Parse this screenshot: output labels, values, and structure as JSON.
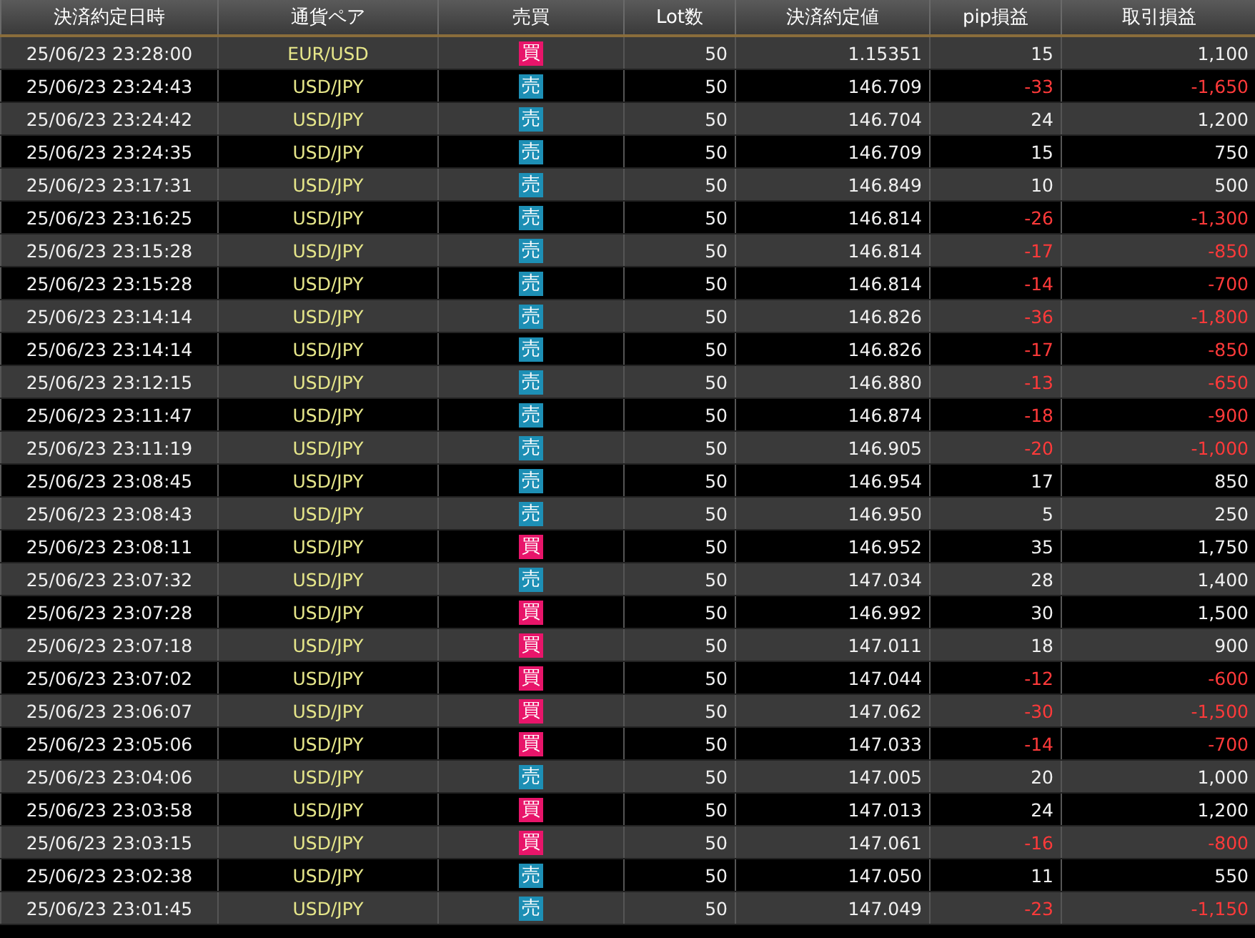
{
  "table": {
    "columns": [
      "決済約定日時",
      "通貨ペア",
      "売買",
      "Lot数",
      "決済約定値",
      "pip損益",
      "取引損益"
    ],
    "rows": [
      {
        "time": "25/06/23 23:28:00",
        "pair": "EUR/USD",
        "side": {
          "label": "買",
          "kind": "buy"
        },
        "lots": "50",
        "price": "1.15351",
        "pips": "15",
        "profit": "1,100",
        "loss": false
      },
      {
        "time": "25/06/23 23:24:43",
        "pair": "USD/JPY",
        "side": {
          "label": "売",
          "kind": "sell"
        },
        "lots": "50",
        "price": "146.709",
        "pips": "-33",
        "profit": "-1,650",
        "loss": true
      },
      {
        "time": "25/06/23 23:24:42",
        "pair": "USD/JPY",
        "side": {
          "label": "売",
          "kind": "sell"
        },
        "lots": "50",
        "price": "146.704",
        "pips": "24",
        "profit": "1,200",
        "loss": false
      },
      {
        "time": "25/06/23 23:24:35",
        "pair": "USD/JPY",
        "side": {
          "label": "売",
          "kind": "sell"
        },
        "lots": "50",
        "price": "146.709",
        "pips": "15",
        "profit": "750",
        "loss": false
      },
      {
        "time": "25/06/23 23:17:31",
        "pair": "USD/JPY",
        "side": {
          "label": "売",
          "kind": "sell"
        },
        "lots": "50",
        "price": "146.849",
        "pips": "10",
        "profit": "500",
        "loss": false
      },
      {
        "time": "25/06/23 23:16:25",
        "pair": "USD/JPY",
        "side": {
          "label": "売",
          "kind": "sell"
        },
        "lots": "50",
        "price": "146.814",
        "pips": "-26",
        "profit": "-1,300",
        "loss": true
      },
      {
        "time": "25/06/23 23:15:28",
        "pair": "USD/JPY",
        "side": {
          "label": "売",
          "kind": "sell"
        },
        "lots": "50",
        "price": "146.814",
        "pips": "-17",
        "profit": "-850",
        "loss": true
      },
      {
        "time": "25/06/23 23:15:28",
        "pair": "USD/JPY",
        "side": {
          "label": "売",
          "kind": "sell"
        },
        "lots": "50",
        "price": "146.814",
        "pips": "-14",
        "profit": "-700",
        "loss": true
      },
      {
        "time": "25/06/23 23:14:14",
        "pair": "USD/JPY",
        "side": {
          "label": "売",
          "kind": "sell"
        },
        "lots": "50",
        "price": "146.826",
        "pips": "-36",
        "profit": "-1,800",
        "loss": true
      },
      {
        "time": "25/06/23 23:14:14",
        "pair": "USD/JPY",
        "side": {
          "label": "売",
          "kind": "sell"
        },
        "lots": "50",
        "price": "146.826",
        "pips": "-17",
        "profit": "-850",
        "loss": true
      },
      {
        "time": "25/06/23 23:12:15",
        "pair": "USD/JPY",
        "side": {
          "label": "売",
          "kind": "sell"
        },
        "lots": "50",
        "price": "146.880",
        "pips": "-13",
        "profit": "-650",
        "loss": true
      },
      {
        "time": "25/06/23 23:11:47",
        "pair": "USD/JPY",
        "side": {
          "label": "売",
          "kind": "sell"
        },
        "lots": "50",
        "price": "146.874",
        "pips": "-18",
        "profit": "-900",
        "loss": true
      },
      {
        "time": "25/06/23 23:11:19",
        "pair": "USD/JPY",
        "side": {
          "label": "売",
          "kind": "sell"
        },
        "lots": "50",
        "price": "146.905",
        "pips": "-20",
        "profit": "-1,000",
        "loss": true
      },
      {
        "time": "25/06/23 23:08:45",
        "pair": "USD/JPY",
        "side": {
          "label": "売",
          "kind": "sell"
        },
        "lots": "50",
        "price": "146.954",
        "pips": "17",
        "profit": "850",
        "loss": false
      },
      {
        "time": "25/06/23 23:08:43",
        "pair": "USD/JPY",
        "side": {
          "label": "売",
          "kind": "sell"
        },
        "lots": "50",
        "price": "146.950",
        "pips": "5",
        "profit": "250",
        "loss": false
      },
      {
        "time": "25/06/23 23:08:11",
        "pair": "USD/JPY",
        "side": {
          "label": "買",
          "kind": "buy"
        },
        "lots": "50",
        "price": "146.952",
        "pips": "35",
        "profit": "1,750",
        "loss": false
      },
      {
        "time": "25/06/23 23:07:32",
        "pair": "USD/JPY",
        "side": {
          "label": "売",
          "kind": "sell"
        },
        "lots": "50",
        "price": "147.034",
        "pips": "28",
        "profit": "1,400",
        "loss": false
      },
      {
        "time": "25/06/23 23:07:28",
        "pair": "USD/JPY",
        "side": {
          "label": "買",
          "kind": "buy"
        },
        "lots": "50",
        "price": "146.992",
        "pips": "30",
        "profit": "1,500",
        "loss": false
      },
      {
        "time": "25/06/23 23:07:18",
        "pair": "USD/JPY",
        "side": {
          "label": "買",
          "kind": "buy"
        },
        "lots": "50",
        "price": "147.011",
        "pips": "18",
        "profit": "900",
        "loss": false
      },
      {
        "time": "25/06/23 23:07:02",
        "pair": "USD/JPY",
        "side": {
          "label": "買",
          "kind": "buy"
        },
        "lots": "50",
        "price": "147.044",
        "pips": "-12",
        "profit": "-600",
        "loss": true
      },
      {
        "time": "25/06/23 23:06:07",
        "pair": "USD/JPY",
        "side": {
          "label": "買",
          "kind": "buy"
        },
        "lots": "50",
        "price": "147.062",
        "pips": "-30",
        "profit": "-1,500",
        "loss": true
      },
      {
        "time": "25/06/23 23:05:06",
        "pair": "USD/JPY",
        "side": {
          "label": "買",
          "kind": "buy"
        },
        "lots": "50",
        "price": "147.033",
        "pips": "-14",
        "profit": "-700",
        "loss": true
      },
      {
        "time": "25/06/23 23:04:06",
        "pair": "USD/JPY",
        "side": {
          "label": "売",
          "kind": "sell"
        },
        "lots": "50",
        "price": "147.005",
        "pips": "20",
        "profit": "1,000",
        "loss": false
      },
      {
        "time": "25/06/23 23:03:58",
        "pair": "USD/JPY",
        "side": {
          "label": "買",
          "kind": "buy"
        },
        "lots": "50",
        "price": "147.013",
        "pips": "24",
        "profit": "1,200",
        "loss": false
      },
      {
        "time": "25/06/23 23:03:15",
        "pair": "USD/JPY",
        "side": {
          "label": "買",
          "kind": "buy"
        },
        "lots": "50",
        "price": "147.061",
        "pips": "-16",
        "profit": "-800",
        "loss": true
      },
      {
        "time": "25/06/23 23:02:38",
        "pair": "USD/JPY",
        "side": {
          "label": "売",
          "kind": "sell"
        },
        "lots": "50",
        "price": "147.050",
        "pips": "11",
        "profit": "550",
        "loss": false
      },
      {
        "time": "25/06/23 23:01:45",
        "pair": "USD/JPY",
        "side": {
          "label": "売",
          "kind": "sell"
        },
        "lots": "50",
        "price": "147.049",
        "pips": "-23",
        "profit": "-1,150",
        "loss": true
      }
    ]
  }
}
